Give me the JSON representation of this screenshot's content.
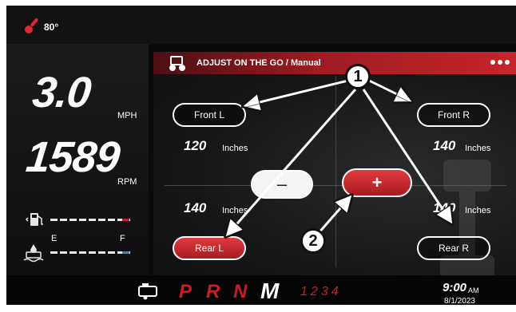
{
  "status": {
    "temperature": "80°",
    "temp_icon": "thermometer-icon"
  },
  "gauges": {
    "speed": "3.0",
    "speed_unit": "MPH",
    "rpm": "1589",
    "rpm_unit": "RPM",
    "fuel_icon": "fuel-pump-icon",
    "def_icon": "def-fluid-icon",
    "empty_label": "E",
    "full_label": "F"
  },
  "panel": {
    "title": "ADJUST ON THE GO / Manual",
    "icon": "tractor-icon",
    "menu_icon": "more-dots-icon"
  },
  "adjust": {
    "front_left": {
      "label": "Front L",
      "value": "120",
      "unit": "Inches"
    },
    "front_right": {
      "label": "Front R",
      "value": "140",
      "unit": "Inches"
    },
    "rear_left": {
      "label": "Rear L",
      "value": "140",
      "unit": "Inches"
    },
    "rear_right": {
      "label": "Rear R",
      "value": "140",
      "unit": "Inches"
    },
    "minus_label": "–",
    "plus_label": "+"
  },
  "footer": {
    "transmission_icon": "transmission-icon",
    "gears": [
      "P",
      "R",
      "N",
      "M"
    ],
    "active_gear": "M",
    "gear_numbers": "1234",
    "time": "9:00",
    "ampm": "AM",
    "date": "8/1/2023"
  },
  "callouts": {
    "one": "1",
    "two": "2"
  },
  "colors": {
    "accent_red": "#c51e25",
    "background": "#0b0b0c",
    "def_blue": "#1e8fe0"
  }
}
